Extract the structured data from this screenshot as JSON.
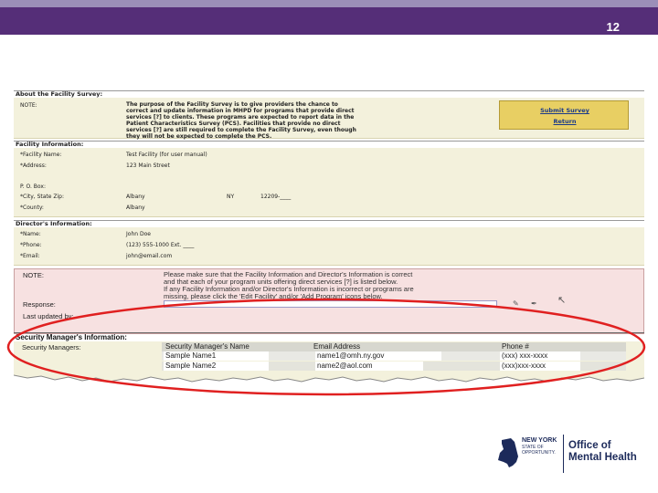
{
  "slide": {
    "number": "12"
  },
  "about": {
    "header": "About the Facility Survey:",
    "note_label": "NOTE:",
    "note_lines": [
      "The purpose of the Facility Survey is to give providers the chance to",
      "correct and update information in MHPD for programs that provide direct",
      "services [?] to clients.  These programs are expected to report data in the",
      "Patient Characteristics Survey (PCS).  Facilities that provide no direct",
      "services [?] are still required to complete the Facility Survey, even though",
      "they will not be expected to complete the PCS."
    ],
    "submit_label": "Submit Survey",
    "return_label": "Return"
  },
  "facility": {
    "header": "Facility Information:",
    "name_label": "*Facility Name:",
    "name_value": "Test Facility (for user manual)",
    "address_label": "*Address:",
    "address_value": "123 Main Street",
    "pobox_label": "P. O. Box:",
    "city_label": "*City, State Zip:",
    "city_value": "Albany",
    "state_value": "NY",
    "zip_value": "12209-____",
    "county_label": "*County:",
    "county_value": "Albany"
  },
  "director": {
    "header": "Director's Information:",
    "name_label": "*Name:",
    "name_value": "John Doe",
    "phone_label": "*Phone:",
    "phone_value": "(123) 555-1000 Ext. ____",
    "email_label": "*Email:",
    "email_value": "john@email.com"
  },
  "review": {
    "note_label": "NOTE:",
    "note_lines": [
      "Please make sure that the Facility Information and Director's Information is correct",
      "and that each of your program units offering direct services [?] is listed below.",
      "If any Facility Information and/or Director's Information is incorrect or programs are",
      "missing, please click the 'Edit Facility' and/or 'Add Program' icons below."
    ],
    "response_label": "Response:",
    "last_updated_label": "Last updated by:"
  },
  "security": {
    "header": "Security Manager's Information:",
    "label": "Security Managers:",
    "columns": [
      "Security Manager's Name",
      "Email Address",
      "Phone #"
    ],
    "rows": [
      [
        "Sample Name1",
        "name1@omh.ny.gov",
        "(xxx) xxx-xxxx"
      ],
      [
        "Sample Name2",
        "name2@aol.com",
        "(xxx)xxx-xxxx"
      ]
    ]
  },
  "logo": {
    "ny_line1": "NEW YORK",
    "ny_line2": "STATE OF",
    "ny_line3": "OPPORTUNITY.",
    "office_line1": "Office of",
    "office_line2": "Mental Health"
  },
  "colors": {
    "header_band": "#552e78",
    "panel_bg": "#f3f1dc",
    "review_bg": "#f7e1e1",
    "highlight_oval": "#e02020",
    "action_box": "#e8cf63"
  }
}
